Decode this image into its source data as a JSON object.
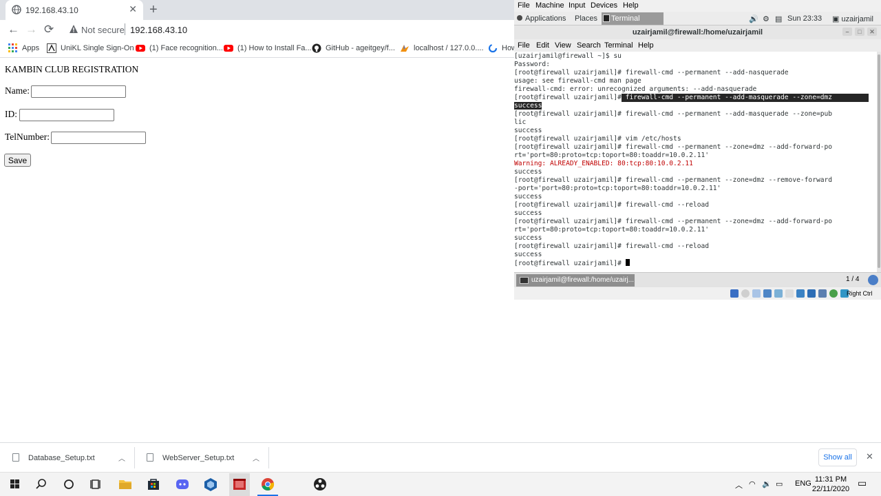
{
  "browser": {
    "tab_title": "192.168.43.10",
    "new_tab": "+",
    "tab_close": "✕",
    "nav": {
      "back": "←",
      "forward": "→",
      "reload": "⟳"
    },
    "address": {
      "security": "Not secure",
      "url": "192.168.43.10"
    },
    "bookmarks": [
      {
        "label": "Apps",
        "icon": "apps-grid-icon"
      },
      {
        "label": "UniKL Single Sign-On",
        "icon": "unikl-icon"
      },
      {
        "label": "(1) Face recognition...",
        "icon": "youtube-icon"
      },
      {
        "label": "(1) How to Install Fa...",
        "icon": "youtube-icon"
      },
      {
        "label": "GitHub - ageitgey/f...",
        "icon": "github-icon"
      },
      {
        "label": "localhost / 127.0.0....",
        "icon": "phpmyadmin-icon"
      },
      {
        "label": "How",
        "icon": "loader-icon"
      }
    ]
  },
  "page": {
    "heading": "KAMBIN CLUB REGISTRATION",
    "fields": [
      {
        "label": "Name:",
        "value": ""
      },
      {
        "label": "ID:",
        "value": ""
      },
      {
        "label": "TelNumber:",
        "value": ""
      }
    ],
    "save_label": "Save"
  },
  "downloads": {
    "items": [
      {
        "name": "Database_Setup.txt"
      },
      {
        "name": "WebServer_Setup.txt"
      }
    ],
    "show_all": "Show all",
    "close": "✕"
  },
  "vm": {
    "menu": [
      "File",
      "Machine",
      "Input",
      "Devices",
      "Help"
    ],
    "gnome": {
      "applications": "Applications",
      "places": "Places",
      "terminal_task": "Terminal",
      "clock": "Sun 23:33",
      "user": "uzairjamil"
    },
    "window_title": "uzairjamil@firewall:/home/uzairjamil",
    "terminal_menu": [
      "File",
      "Edit",
      "View",
      "Search",
      "Terminal",
      "Help"
    ],
    "terminal_lines": [
      {
        "prompt": "",
        "text": "[uzairjamil@firewall ~]$ su"
      },
      {
        "prompt": "",
        "text": "Password:"
      },
      {
        "prompt": "",
        "text": "[root@firewall uzairjamil]# firewall-cmd --permanent --add-nasquerade"
      },
      {
        "prompt": "",
        "text": "usage: see firewall-cmd man page"
      },
      {
        "prompt": "",
        "text": "firewall-cmd: error: unrecognized arguments: --add-nasquerade"
      },
      {
        "prompt": "[root@firewall uzairjamil]#",
        "text": " firewall-cmd --permanent --add-masquerade --zone=dmz",
        "highlight": true
      },
      {
        "prompt": "",
        "text": "success",
        "highlight_full": true
      },
      {
        "prompt": "",
        "text": "[root@firewall uzairjamil]# firewall-cmd --permanent --add-masquerade --zone=pub"
      },
      {
        "prompt": "",
        "text": "lic"
      },
      {
        "prompt": "",
        "text": "success"
      },
      {
        "prompt": "",
        "text": "[root@firewall uzairjamil]# vim /etc/hosts"
      },
      {
        "prompt": "",
        "text": "[root@firewall uzairjamil]# firewall-cmd --permanent --zone=dmz --add-forward-po"
      },
      {
        "prompt": "",
        "text": "rt='port=80:proto=tcp:toport=80:toaddr=10.0.2.11'"
      },
      {
        "prompt": "",
        "text": "Warning: ALREADY_ENABLED: 80:tcp:80:10.0.2.11",
        "warning": true
      },
      {
        "prompt": "",
        "text": "success"
      },
      {
        "prompt": "",
        "text": "[root@firewall uzairjamil]# firewall-cmd --permanent --zone=dmz --remove-forward"
      },
      {
        "prompt": "",
        "text": "-port='port=80:proto=tcp:toport=80:toaddr=10.0.2.11'"
      },
      {
        "prompt": "",
        "text": "success"
      },
      {
        "prompt": "",
        "text": "[root@firewall uzairjamil]# firewall-cmd --reload"
      },
      {
        "prompt": "",
        "text": "success"
      },
      {
        "prompt": "",
        "text": "[root@firewall uzairjamil]# firewall-cmd --permanent --zone=dmz --add-forward-po"
      },
      {
        "prompt": "",
        "text": "rt='port=80:proto=tcp:toport=80:toaddr=10.0.2.11'"
      },
      {
        "prompt": "",
        "text": "success"
      },
      {
        "prompt": "",
        "text": "[root@firewall uzairjamil]# firewall-cmd --reload"
      },
      {
        "prompt": "",
        "text": "success"
      },
      {
        "prompt": "",
        "text": "[root@firewall uzairjamil]# ",
        "cursor": true
      }
    ],
    "task_button": "uzairjamil@firewall:/home/uzairj...",
    "workspace": "1 / 4",
    "host_key": "Right Ctrl"
  },
  "taskbar": {
    "icons": [
      "windows-start-icon",
      "search-icon",
      "cortana-icon",
      "task-view-icon",
      "file-explorer-icon",
      "store-icon",
      "discord-icon",
      "virtualbox-icon",
      "app-icon",
      "chrome-icon",
      "obs-icon"
    ],
    "language": "ENG",
    "time": "11:31 PM",
    "date": "22/11/2020"
  },
  "colors": {
    "terminal_highlight": "#262626",
    "warning_text": "#c00000",
    "link_blue": "#1a73e8",
    "chrome_tabstrip": "#dee1e6"
  }
}
